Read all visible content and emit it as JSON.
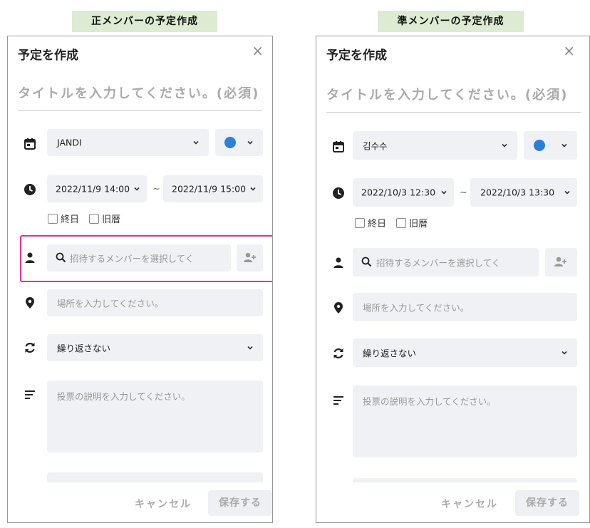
{
  "left": {
    "label": "正メンバーの予定作成",
    "dialog_title": "予定を作成",
    "title_placeholder": "タイトルを入力してください。(必須)",
    "calendar_value": "JANDI",
    "start_datetime": "2022/11/9 14:00",
    "end_datetime": "2022/11/9 15:00",
    "tilde": "~",
    "allday_label": "終日",
    "lunar_label": "旧暦",
    "invite_placeholder": "招待するメンバーを選択してく",
    "location_placeholder": "場所を入力してください。",
    "repeat_value": "繰り返さない",
    "description_placeholder": "投票の説明を入力してください。",
    "cancel_label": "キャンセル",
    "save_label": "保存する"
  },
  "right": {
    "label": "準メンバーの予定作成",
    "dialog_title": "予定を作成",
    "title_placeholder": "タイトルを入力してください。(必須)",
    "calendar_value": "김수수",
    "start_datetime": "2022/10/3 12:30",
    "end_datetime": "2022/10/3 13:30",
    "tilde": "~",
    "allday_label": "終日",
    "lunar_label": "旧暦",
    "invite_placeholder": "招待するメンバーを選択してく",
    "location_placeholder": "場所を入力してください。",
    "repeat_value": "繰り返さない",
    "description_placeholder": "投票の説明を入力してください。",
    "cancel_label": "キャンセル",
    "save_label": "保存する"
  },
  "colors": {
    "calendar_dot": "#2b80d8",
    "highlight": "#e62d9c",
    "label_bg": "#dcebd2"
  },
  "icons": [
    "calendar-icon",
    "clock-icon",
    "person-icon",
    "map-pin-icon",
    "repeat-icon",
    "description-icon",
    "search-icon",
    "add-user-icon",
    "chevron-down-icon",
    "close-icon"
  ]
}
